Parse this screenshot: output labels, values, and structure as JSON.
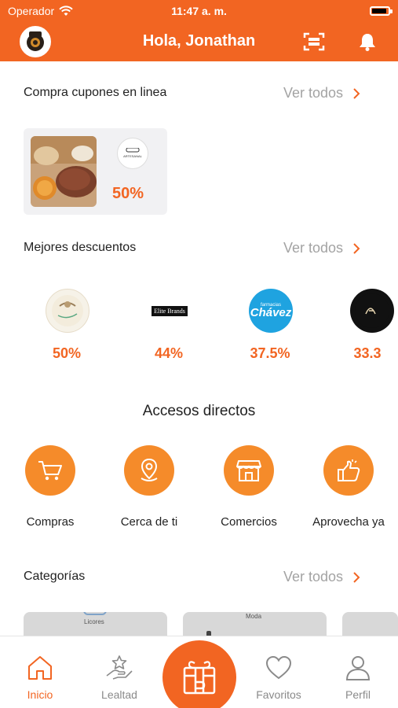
{
  "status_bar": {
    "carrier": "Operador",
    "time": "11:47 a. m."
  },
  "header": {
    "greeting": "Hola, Jonathan"
  },
  "coupons": {
    "title": "Compra cupones en linea",
    "see_all": "Ver todos",
    "items": [
      {
        "logo_text": "ARTESANAL",
        "discount": "50%"
      }
    ]
  },
  "discounts": {
    "title": "Mejores descuentos",
    "see_all": "Ver todos",
    "items": [
      {
        "logo_text": "",
        "discount": "50%"
      },
      {
        "logo_text": "Elite Brands",
        "discount": "44%"
      },
      {
        "logo_text": "Chávez",
        "logo_subtext": "farmacias",
        "discount": "37.5%"
      },
      {
        "logo_text": "",
        "discount": "33.3"
      }
    ]
  },
  "shortcuts": {
    "title": "Accesos directos",
    "items": [
      {
        "label": "Compras",
        "icon": "cart-icon"
      },
      {
        "label": "Cerca de ti",
        "icon": "location-pin-icon"
      },
      {
        "label": "Comercios",
        "icon": "store-icon"
      },
      {
        "label": "Aprovecha ya",
        "icon": "thumbs-up-icon"
      }
    ]
  },
  "categories": {
    "title": "Categorías",
    "see_all": "Ver todos",
    "items": [
      {
        "label": "Licores"
      },
      {
        "label": "Moda"
      }
    ]
  },
  "bottom_nav": {
    "items": [
      {
        "label": "Inicio",
        "icon": "home-icon",
        "active": true
      },
      {
        "label": "Lealtad",
        "icon": "loyalty-hand-star-icon",
        "active": false
      },
      {
        "label": "Favoritos",
        "icon": "heart-icon",
        "active": false
      },
      {
        "label": "Perfil",
        "icon": "user-icon",
        "active": false
      }
    ],
    "center_icon": "gift-coupon-icon"
  },
  "colors": {
    "brand": "#f26522",
    "shortcut_circle": "#f58b2a",
    "muted": "#a3a3a3",
    "card_bg": "#f1f1f3"
  }
}
